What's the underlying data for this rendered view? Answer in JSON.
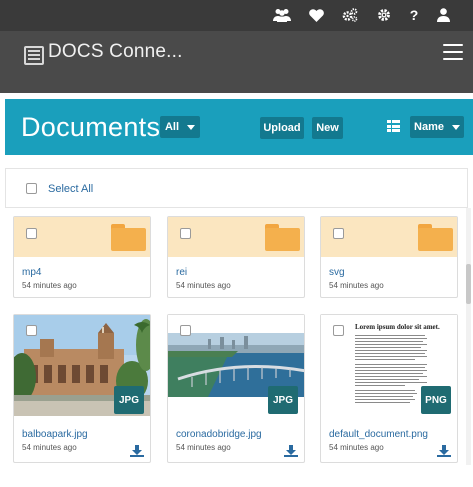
{
  "topbar": {
    "icons": [
      "users-icon",
      "heart-icon",
      "cogs-icon",
      "gear-icon",
      "help-icon",
      "user-icon"
    ],
    "help_glyph": "?"
  },
  "brand": {
    "title": "DOCS Conne..."
  },
  "documents": {
    "title": "Documents",
    "filter_label": "All",
    "upload_label": "Upload",
    "new_label": "New",
    "sort_label": "Name"
  },
  "select_all_label": "Select All",
  "folders": [
    {
      "name": "mp4",
      "time": "54 minutes ago"
    },
    {
      "name": "rei",
      "time": "54 minutes ago"
    },
    {
      "name": "svg",
      "time": "54 minutes ago"
    }
  ],
  "files": [
    {
      "name": "balboapark.jpg",
      "time": "54 minutes ago",
      "type": "JPG"
    },
    {
      "name": "coronadobridge.jpg",
      "time": "54 minutes ago",
      "type": "JPG"
    },
    {
      "name": "default_document.png",
      "time": "54 minutes ago",
      "type": "PNG"
    }
  ],
  "preview_doc": {
    "heading": "Lorem ipsum dolor sit amet."
  },
  "colors": {
    "topbar": "#3a3a3a",
    "brandbar": "#4a4a4a",
    "header": "#1a9fbc",
    "header_button": "#13798f",
    "badge": "#1f6b72",
    "link": "#2a6aa0",
    "folder_bg": "#fbe6c0",
    "folder": "#f4b04d"
  }
}
